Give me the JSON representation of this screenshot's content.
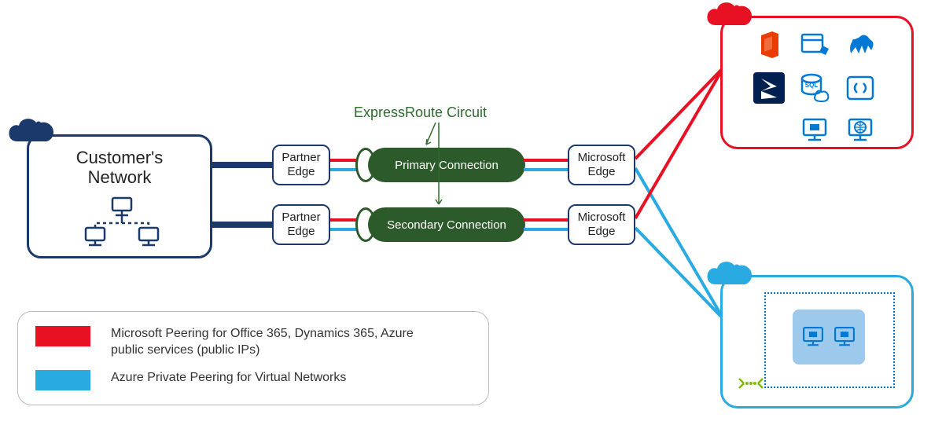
{
  "customer": {
    "label": "Customer's\nNetwork"
  },
  "partnerEdge": {
    "label1": "Partner Edge",
    "label2": "Partner Edge"
  },
  "circuit": {
    "title": "ExpressRoute Circuit",
    "primary": "Primary Connection",
    "secondary": "Secondary Connection"
  },
  "msEdge": {
    "label1": "Microsoft Edge",
    "label2": "Microsoft Edge"
  },
  "legend": {
    "ms_peering": "Microsoft Peering for Office 365, Dynamics 365, Azure public services (public IPs)",
    "private_peering": "Azure Private Peering for Virtual Networks"
  },
  "colors": {
    "navy": "#1b3a6b",
    "red": "#e81123",
    "blue": "#29abe2",
    "blue_border": "#29abe2",
    "green": "#2d5a2a",
    "green_text": "#2d6b2d"
  },
  "services_cloud": {
    "icons": [
      "office-365-icon",
      "azure-storage-icon",
      "hdinsight-icon",
      "dynamics-365-icon",
      "sql-database-icon",
      "code-service-icon",
      "",
      "vm-service-icon",
      "web-app-icon"
    ]
  }
}
